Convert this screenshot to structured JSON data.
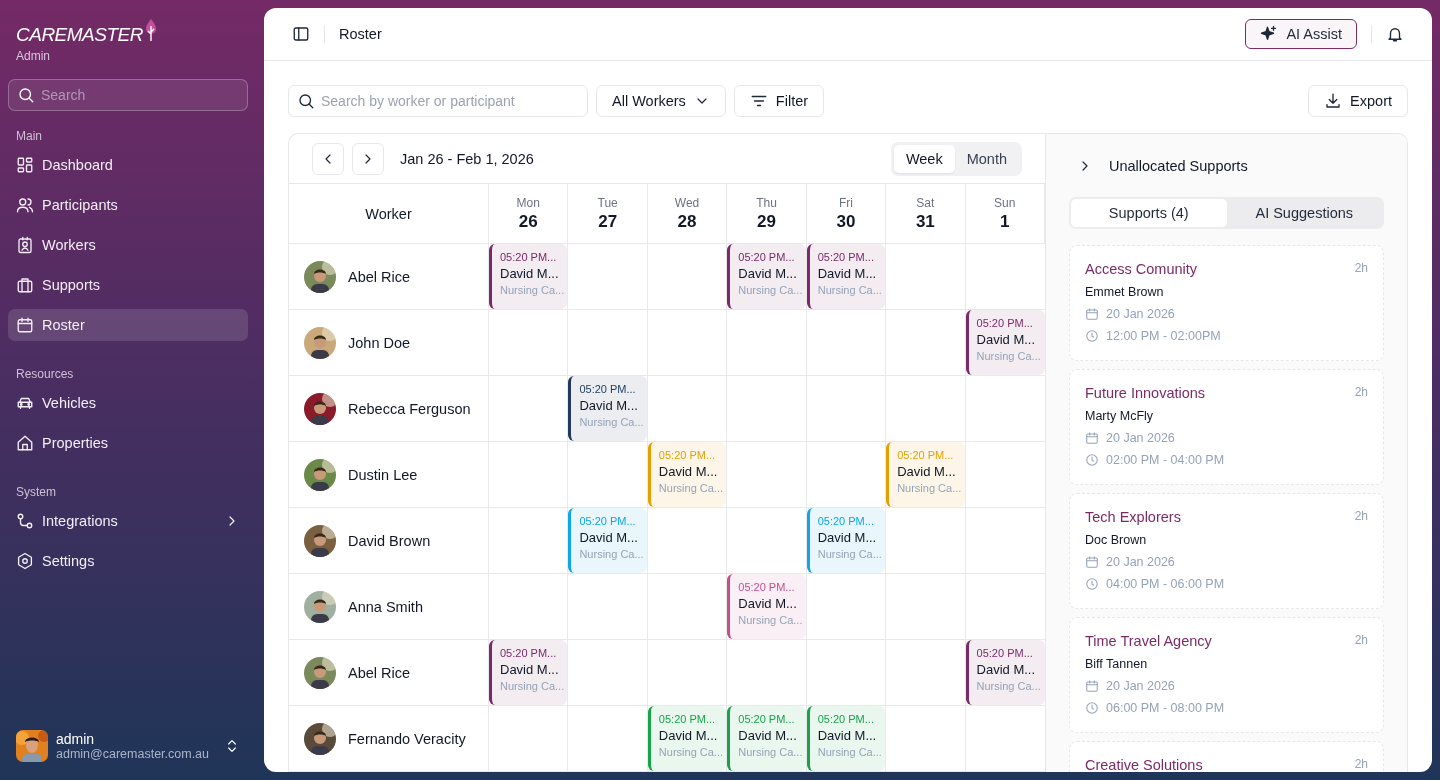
{
  "brand": {
    "logo": "**CARE**MASTER",
    "role": "Admin"
  },
  "sidebar": {
    "search": {
      "placeholder": "Search"
    },
    "sections": [
      {
        "title": "Main",
        "items": [
          {
            "label": "Dashboard",
            "selected": false,
            "expandable": false
          },
          {
            "label": "Participants",
            "selected": false,
            "expandable": false
          },
          {
            "label": "Workers",
            "selected": false,
            "expandable": false
          },
          {
            "label": "Supports",
            "selected": false,
            "expandable": false
          },
          {
            "label": "Roster",
            "selected": true,
            "expandable": false
          }
        ]
      },
      {
        "title": "Resources",
        "items": [
          {
            "label": "Vehicles",
            "selected": false,
            "expandable": false
          },
          {
            "label": "Properties",
            "selected": false,
            "expandable": false
          }
        ]
      },
      {
        "title": "System",
        "items": [
          {
            "label": "Integrations",
            "selected": false,
            "expandable": true
          },
          {
            "label": "Settings",
            "selected": false,
            "expandable": false
          }
        ]
      }
    ],
    "user": {
      "name": "admin",
      "email": "admin@caremaster.com.au"
    }
  },
  "header": {
    "title": "Roster",
    "ai_button": "AI Assist"
  },
  "toolbar": {
    "search": {
      "placeholder": "Search by worker or participant"
    },
    "worker_filter": "All Workers",
    "filter_button": "Filter",
    "export_button": "Export"
  },
  "calendar": {
    "range": "Jan 26 - Feb 1, 2026",
    "views": [
      {
        "label": "Week",
        "selected": true
      },
      {
        "label": "Month",
        "selected": false
      }
    ],
    "worker_heading": "Worker",
    "days": [
      {
        "name": "Mon",
        "date": "26"
      },
      {
        "name": "Tue",
        "date": "27"
      },
      {
        "name": "Wed",
        "date": "28"
      },
      {
        "name": "Thu",
        "date": "29"
      },
      {
        "name": "Fri",
        "date": "30"
      },
      {
        "name": "Sat",
        "date": "31"
      },
      {
        "name": "Sun",
        "date": "1"
      }
    ],
    "rows": [
      {
        "name": "Abel Rice",
        "cells": [
          {
            "time": "05:20 PM...",
            "person": "David M...",
            "type": "Nursing Ca...",
            "color": "#7b2a68"
          },
          null,
          null,
          {
            "time": "05:20 PM...",
            "person": "David M...",
            "type": "Nursing Ca...",
            "color": "#7b2a68"
          },
          {
            "time": "05:20 PM...",
            "person": "David M...",
            "type": "Nursing Ca...",
            "color": "#7b2a68"
          },
          null,
          null
        ]
      },
      {
        "name": "John Doe",
        "cells": [
          null,
          null,
          null,
          null,
          null,
          null,
          {
            "time": "05:20 PM...",
            "person": "David M...",
            "type": "Nursing Ca...",
            "color": "#7b2a68"
          }
        ]
      },
      {
        "name": "Rebecca Ferguson",
        "cells": [
          null,
          {
            "time": "05:20 PM...",
            "person": "David M...",
            "type": "Nursing Ca...",
            "color": "#1e3a5f"
          },
          null,
          null,
          null,
          null,
          null
        ]
      },
      {
        "name": "Dustin Lee",
        "cells": [
          null,
          null,
          {
            "time": "05:20 PM...",
            "person": "David M...",
            "type": "Nursing Ca...",
            "color": "#e5a000"
          },
          null,
          null,
          {
            "time": "05:20 PM...",
            "person": "David M...",
            "type": "Nursing Ca...",
            "color": "#e5a000"
          },
          null
        ]
      },
      {
        "name": "David Brown",
        "cells": [
          null,
          {
            "time": "05:20 PM...",
            "person": "David M...",
            "type": "Nursing Ca...",
            "color": "#0ea5e9"
          },
          null,
          null,
          {
            "time": "05:20 PM...",
            "person": "David M...",
            "type": "Nursing Ca...",
            "color": "#0ea5e9"
          },
          null,
          null
        ]
      },
      {
        "name": "Anna Smith",
        "cells": [
          null,
          null,
          null,
          {
            "time": "05:20 PM...",
            "person": "David M...",
            "type": "Nursing Ca...",
            "color": "#c2508f"
          },
          null,
          null,
          null
        ]
      },
      {
        "name": "Abel Rice",
        "cells": [
          {
            "time": "05:20 PM...",
            "person": "David M...",
            "type": "Nursing Ca...",
            "color": "#7b2a68"
          },
          null,
          null,
          null,
          null,
          null,
          {
            "time": "05:20 PM...",
            "person": "David M...",
            "type": "Nursing Ca...",
            "color": "#7b2a68"
          }
        ]
      },
      {
        "name": "Fernando Veracity",
        "cells": [
          null,
          null,
          {
            "time": "05:20 PM...",
            "person": "David M...",
            "type": "Nursing Ca...",
            "color": "#16a34a"
          },
          {
            "time": "05:20 PM...",
            "person": "David M...",
            "type": "Nursing Ca...",
            "color": "#16a34a"
          },
          {
            "time": "05:20 PM...",
            "person": "David M...",
            "type": "Nursing Ca...",
            "color": "#16a34a"
          },
          null,
          null
        ]
      }
    ]
  },
  "unallocated": {
    "title": "Unallocated Supports",
    "tabs": [
      {
        "label": "Supports (4)",
        "selected": true
      },
      {
        "label": "AI Suggestions",
        "selected": false
      }
    ],
    "cards": [
      {
        "title": "Access Comunity",
        "duration": "2h",
        "person": "Emmet Brown",
        "date": "20 Jan 2026",
        "time": "12:00 PM - 02:00PM"
      },
      {
        "title": "Future Innovations",
        "duration": "2h",
        "person": "Marty McFly",
        "date": "20 Jan 2026",
        "time": "02:00 PM - 04:00 PM"
      },
      {
        "title": "Tech Explorers",
        "duration": "2h",
        "person": "Doc Brown",
        "date": "20 Jan 2026",
        "time": "04:00 PM - 06:00 PM"
      },
      {
        "title": "Time Travel Agency",
        "duration": "2h",
        "person": "Biff Tannen",
        "date": "20 Jan 2026",
        "time": "06:00 PM - 08:00 PM"
      },
      {
        "title": "Creative Solutions",
        "duration": "2h"
      }
    ]
  }
}
